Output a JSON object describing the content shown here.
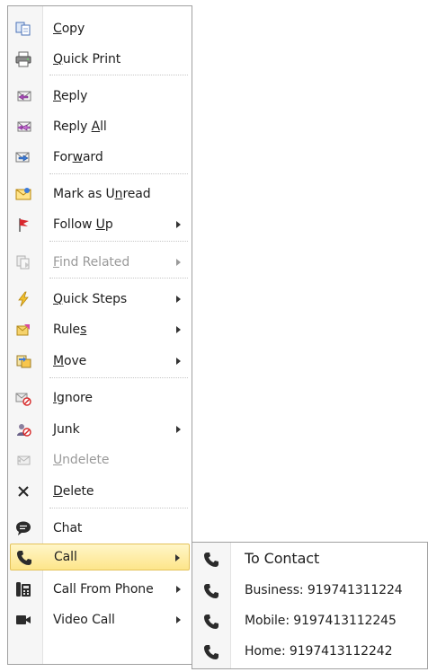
{
  "menu": {
    "items": [
      {
        "label_pre": "",
        "label_ul": "C",
        "label_post": "opy"
      },
      {
        "label_pre": "",
        "label_ul": "Q",
        "label_post": "uick Print"
      },
      {
        "label_pre": "",
        "label_ul": "R",
        "label_post": "eply"
      },
      {
        "label_pre": "Reply ",
        "label_ul": "A",
        "label_post": "ll"
      },
      {
        "label_pre": "For",
        "label_ul": "w",
        "label_post": "ard"
      },
      {
        "label_pre": "Mark as U",
        "label_ul": "n",
        "label_post": "read"
      },
      {
        "label_pre": "Follow ",
        "label_ul": "U",
        "label_post": "p"
      },
      {
        "label_pre": "",
        "label_ul": "F",
        "label_post": "ind Related"
      },
      {
        "label_pre": "",
        "label_ul": "Q",
        "label_post": "uick Steps"
      },
      {
        "label_pre": "Rule",
        "label_ul": "s",
        "label_post": ""
      },
      {
        "label_pre": "",
        "label_ul": "M",
        "label_post": "ove"
      },
      {
        "label_pre": "",
        "label_ul": "I",
        "label_post": "gnore"
      },
      {
        "label_pre": "",
        "label_ul": "J",
        "label_post": "unk"
      },
      {
        "label_pre": "",
        "label_ul": "U",
        "label_post": "ndelete"
      },
      {
        "label_pre": "",
        "label_ul": "D",
        "label_post": "elete"
      },
      {
        "label": "Chat"
      },
      {
        "label": "Call"
      },
      {
        "label": "Call From Phone"
      },
      {
        "label": "Video Call"
      }
    ]
  },
  "submenu": {
    "title": "To Contact",
    "items": [
      {
        "label": "Business: 919741311224"
      },
      {
        "label": "Mobile: 9197413112245"
      },
      {
        "label": "Home: 9197413112242"
      }
    ]
  },
  "colors": {
    "highlight_top": "#fff6c8",
    "highlight_bottom": "#fde58a",
    "disabled_text": "#9a9a9a",
    "border": "#a0a0a0"
  }
}
